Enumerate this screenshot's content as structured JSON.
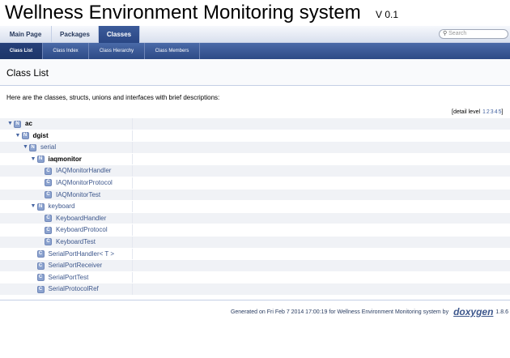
{
  "project": {
    "name": "Wellness Environment Monitoring system",
    "number": "V 0.1"
  },
  "tabs": [
    {
      "label": "Main Page",
      "current": false
    },
    {
      "label": "Packages",
      "current": false
    },
    {
      "label": "Classes",
      "current": true
    }
  ],
  "search": {
    "placeholder": "Search"
  },
  "subtabs": [
    {
      "label": "Class List",
      "current": true
    },
    {
      "label": "Class Index",
      "current": false
    },
    {
      "label": "Class Hierarchy",
      "current": false
    },
    {
      "label": "Class Members",
      "current": false
    }
  ],
  "header": {
    "title": "Class List"
  },
  "intro": "Here are the classes, structs, unions and interfaces with brief descriptions:",
  "detail_level": {
    "label": "[detail level",
    "levels": [
      "1",
      "2",
      "3",
      "4",
      "5"
    ],
    "suffix": "]"
  },
  "tree": [
    {
      "name": "ac",
      "kind": "N",
      "level": 0,
      "expandable": true,
      "bold": true
    },
    {
      "name": "dgist",
      "kind": "N",
      "level": 1,
      "expandable": true,
      "bold": true
    },
    {
      "name": "serial",
      "kind": "N",
      "level": 2,
      "expandable": true,
      "bold": false
    },
    {
      "name": "iaqmonitor",
      "kind": "N",
      "level": 3,
      "expandable": true,
      "bold": true
    },
    {
      "name": "IAQMonitorHandler",
      "kind": "C",
      "level": 4,
      "expandable": false,
      "bold": false
    },
    {
      "name": "IAQMonitorProtocol",
      "kind": "C",
      "level": 4,
      "expandable": false,
      "bold": false
    },
    {
      "name": "IAQMonitorTest",
      "kind": "C",
      "level": 4,
      "expandable": false,
      "bold": false
    },
    {
      "name": "keyboard",
      "kind": "N",
      "level": 3,
      "expandable": true,
      "bold": false
    },
    {
      "name": "KeyboardHandler",
      "kind": "C",
      "level": 4,
      "expandable": false,
      "bold": false
    },
    {
      "name": "KeyboardProtocol",
      "kind": "C",
      "level": 4,
      "expandable": false,
      "bold": false
    },
    {
      "name": "KeyboardTest",
      "kind": "C",
      "level": 4,
      "expandable": false,
      "bold": false
    },
    {
      "name": "SerialPortHandler< T >",
      "kind": "C",
      "level": 3,
      "expandable": false,
      "bold": false
    },
    {
      "name": "SerialPortReceiver",
      "kind": "C",
      "level": 3,
      "expandable": false,
      "bold": false
    },
    {
      "name": "SerialPortTest",
      "kind": "C",
      "level": 3,
      "expandable": false,
      "bold": false
    },
    {
      "name": "SerialProtocolRef",
      "kind": "C",
      "level": 3,
      "expandable": false,
      "bold": false
    }
  ],
  "footer": {
    "text": "Generated on Fri Feb 7 2014 17:00:19 for Wellness Environment Monitoring system by",
    "logo": "doxygen",
    "version": "1.8.6"
  },
  "colors": {
    "tab_active": "#2a4785",
    "link": "#3d578c",
    "row_alt": "#f0f2f6",
    "icon_box": "#8ca3cf"
  }
}
